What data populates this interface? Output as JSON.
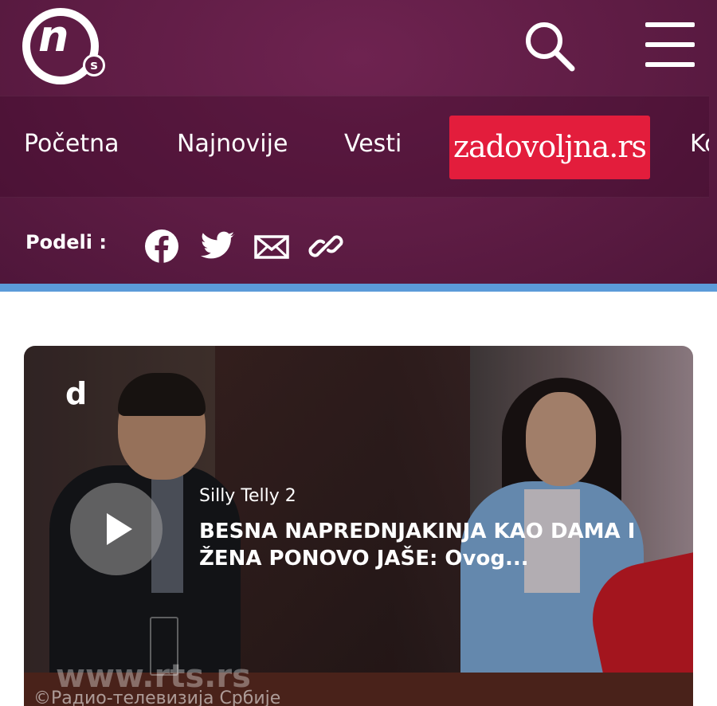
{
  "header": {
    "logo_letter": "n",
    "logo_sub": "s",
    "search_icon": "search-icon",
    "menu_icon": "hamburger-menu-icon"
  },
  "nav": {
    "items": [
      "Početna",
      "Najnovije",
      "Vesti",
      "zadovoljna.rs",
      "Ko"
    ]
  },
  "share": {
    "label": "Podeli :",
    "icons": [
      "facebook-icon",
      "twitter-icon",
      "mail-icon",
      "link-icon"
    ]
  },
  "video": {
    "channel_logo": "d",
    "show": "Silly Telly 2",
    "title": "BESNA NAPREDNJAKINJA KAO DAMA I ŽENA PONOVO JAŠE: Ovog...",
    "watermark": "www.rts.rs",
    "watermark_caption": "©Радио-телевизија Србије"
  },
  "colors": {
    "header_bg": "#5e1c44",
    "brand_red": "#e31d3c",
    "accent_line": "#5b9bd9"
  }
}
